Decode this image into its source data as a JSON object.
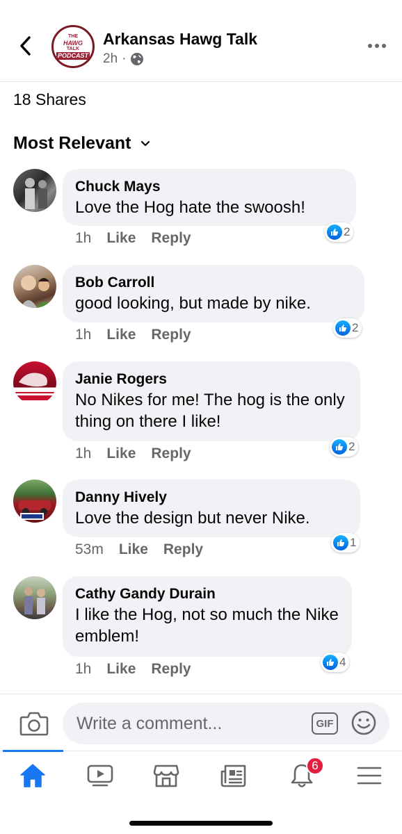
{
  "header": {
    "page_name": "Arkansas Hawg Talk",
    "time": "2h",
    "logo_text": [
      "THE",
      "HAWG",
      "TALK",
      "PODCAST"
    ]
  },
  "shares_text": "18 Shares",
  "sort_label": "Most Relevant",
  "comments": [
    {
      "author": "Chuck Mays",
      "text": "Love the Hog hate the swoosh!",
      "time": "1h",
      "like": "Like",
      "reply": "Reply",
      "reactions": "2"
    },
    {
      "author": "Bob Carroll",
      "text": "good looking, but made by nike.",
      "time": "1h",
      "like": "Like",
      "reply": "Reply",
      "reactions": "2"
    },
    {
      "author": "Janie Rogers",
      "text": "No Nikes for me! The hog is the only thing on there I like!",
      "time": "1h",
      "like": "Like",
      "reply": "Reply",
      "reactions": "2"
    },
    {
      "author": "Danny Hively",
      "text": "Love the design but never Nike.",
      "time": "53m",
      "like": "Like",
      "reply": "Reply",
      "reactions": "1"
    },
    {
      "author": "Cathy Gandy Durain",
      "text": "I like the Hog, not so much the Nike emblem!",
      "time": "1h",
      "like": "Like",
      "reply": "Reply",
      "reactions": "4"
    }
  ],
  "composer": {
    "placeholder": "Write a comment...",
    "gif_label": "GIF"
  },
  "tabbar": {
    "notifications_count": "6"
  },
  "colors": {
    "accent": "#1877f2",
    "badge": "#e41e3f",
    "bubble": "#f0f2f5",
    "secondary_text": "#65676b"
  }
}
